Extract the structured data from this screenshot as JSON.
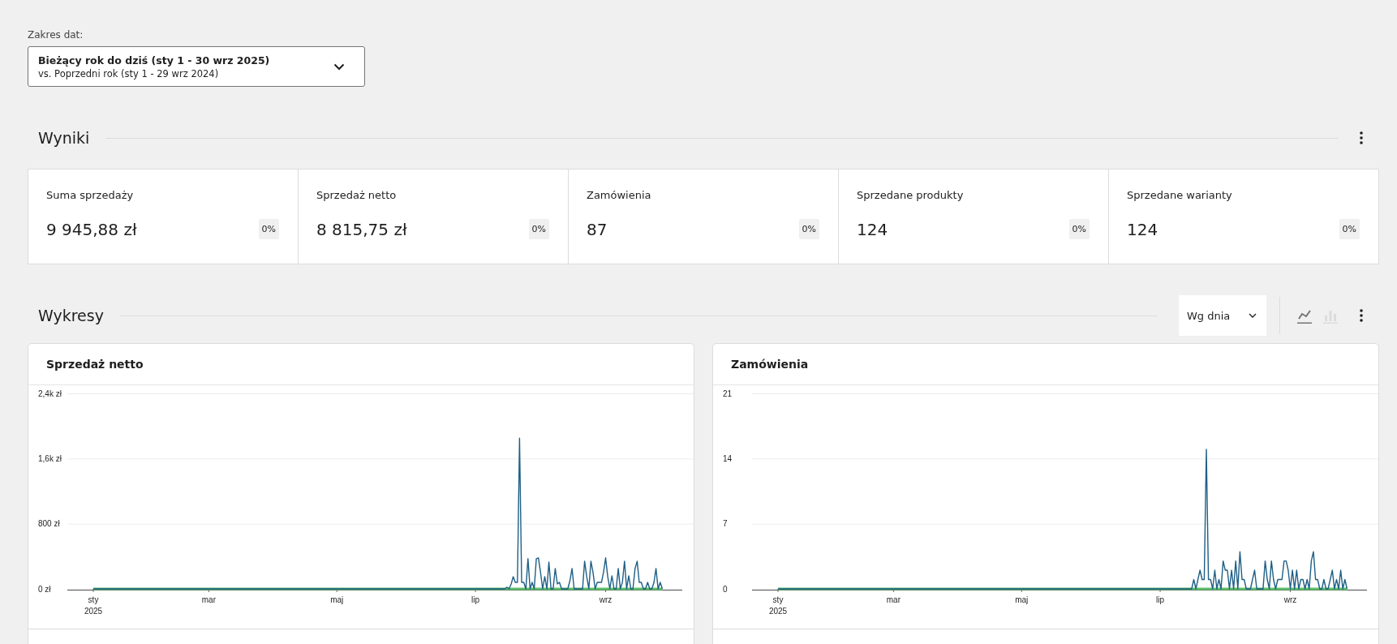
{
  "date_range": {
    "label": "Zakres dat:",
    "primary": "Bieżący rok do dziś (sty 1 - 30 wrz 2025)",
    "secondary": "vs. Poprzedni rok (sty 1 - 29 wrz 2024)"
  },
  "results": {
    "title": "Wyniki",
    "cards": [
      {
        "label": "Suma sprzedaży",
        "value": "9 945,88 zł",
        "delta": "0%"
      },
      {
        "label": "Sprzedaż netto",
        "value": "8 815,75 zł",
        "delta": "0%"
      },
      {
        "label": "Zamówienia",
        "value": "87",
        "delta": "0%"
      },
      {
        "label": "Sprzedane produkty",
        "value": "124",
        "delta": "0%"
      },
      {
        "label": "Sprzedane warianty",
        "value": "124",
        "delta": "0%"
      }
    ]
  },
  "charts": {
    "title": "Wykresy",
    "interval": "Wg dnia",
    "chart_types": [
      {
        "kind": "line",
        "selected": true
      },
      {
        "kind": "bar",
        "selected": false
      }
    ],
    "panels": [
      {
        "title": "Sprzedaż netto",
        "chart_data": {
          "type": "line",
          "categories": [
            "sty\n2025",
            null,
            null,
            null,
            null,
            null,
            null,
            null,
            null,
            null,
            null,
            null,
            null,
            null,
            null,
            null,
            null,
            null,
            null,
            null,
            null,
            null,
            null,
            null,
            null,
            null,
            null,
            null,
            null,
            null,
            null,
            null,
            null,
            null,
            null,
            null,
            null,
            null,
            null,
            null,
            null,
            null,
            null,
            null,
            null,
            null,
            null,
            null,
            null,
            null,
            null,
            null,
            null,
            null,
            null,
            "mar",
            null,
            null,
            null,
            null,
            null,
            null,
            null,
            null,
            null,
            null,
            null,
            null,
            null,
            null,
            null,
            null,
            null,
            null,
            null,
            null,
            null,
            null,
            null,
            null,
            null,
            null,
            null,
            null,
            null,
            null,
            null,
            null,
            null,
            null,
            null,
            null,
            null,
            null,
            null,
            null,
            null,
            null,
            null,
            null,
            null,
            null,
            null,
            null,
            null,
            null,
            null,
            null,
            null,
            null,
            null,
            null,
            null,
            null,
            null,
            null,
            "maj",
            null,
            null,
            null,
            null,
            null,
            null,
            null,
            null,
            null,
            null,
            null,
            null,
            null,
            null,
            null,
            null,
            null,
            null,
            null,
            null,
            null,
            null,
            null,
            null,
            null,
            null,
            null,
            null,
            null,
            null,
            null,
            null,
            null,
            null,
            null,
            null,
            null,
            null,
            null,
            null,
            null,
            null,
            null,
            null,
            null,
            null,
            null,
            null,
            null,
            null,
            null,
            null,
            null,
            null,
            null,
            null,
            null,
            null,
            null,
            null,
            null,
            null,
            null,
            null,
            null,
            "lip",
            null,
            null,
            null,
            null,
            null,
            null,
            null,
            null,
            null,
            null,
            null,
            null,
            null,
            null,
            null,
            null,
            null,
            null,
            null,
            null,
            null,
            null,
            null,
            null,
            null,
            null,
            null,
            null,
            null,
            null,
            null,
            null,
            null,
            null,
            null,
            null,
            null,
            null,
            null,
            null,
            null,
            null,
            null,
            null,
            null,
            null,
            null,
            null,
            null,
            null,
            null,
            null,
            null,
            null,
            null,
            null,
            null,
            null,
            null,
            null,
            null,
            "wrz",
            null,
            null,
            null,
            null,
            null,
            null,
            null,
            null,
            null,
            null,
            null,
            null,
            null,
            null,
            null,
            null,
            null,
            null,
            null,
            null,
            null,
            null,
            null,
            null,
            null,
            null,
            null
          ],
          "series": [
            {
              "color": "#1f5f86",
              "values": [
                0,
                0,
                0,
                0,
                0,
                0,
                0,
                0,
                0,
                0,
                0,
                0,
                0,
                0,
                0,
                0,
                0,
                0,
                0,
                0,
                0,
                0,
                0,
                0,
                0,
                0,
                0,
                0,
                0,
                0,
                0,
                0,
                0,
                0,
                0,
                0,
                0,
                0,
                0,
                0,
                0,
                0,
                0,
                0,
                0,
                0,
                0,
                0,
                0,
                0,
                0,
                0,
                0,
                0,
                0,
                0,
                0,
                0,
                0,
                0,
                0,
                0,
                0,
                0,
                0,
                0,
                0,
                0,
                0,
                0,
                0,
                0,
                0,
                0,
                0,
                0,
                0,
                0,
                0,
                0,
                0,
                0,
                0,
                0,
                0,
                0,
                0,
                0,
                0,
                0,
                0,
                0,
                0,
                0,
                0,
                0,
                0,
                0,
                0,
                0,
                0,
                0,
                0,
                0,
                0,
                0,
                0,
                0,
                0,
                0,
                0,
                0,
                0,
                0,
                0,
                0,
                0,
                0,
                0,
                0,
                0,
                0,
                0,
                0,
                0,
                0,
                0,
                0,
                0,
                0,
                0,
                0,
                0,
                0,
                0,
                0,
                0,
                0,
                0,
                0,
                0,
                0,
                0,
                0,
                0,
                0,
                0,
                0,
                0,
                0,
                0,
                0,
                0,
                0,
                0,
                0,
                0,
                0,
                0,
                0,
                0,
                0,
                0,
                0,
                0,
                0,
                0,
                0,
                0,
                0,
                0,
                0,
                0,
                0,
                0,
                0,
                0,
                0,
                0,
                0,
                0,
                0,
                0,
                0,
                0,
                0,
                0,
                0,
                0,
                0,
                0,
                0,
                0,
                0,
                0,
                0,
                0,
                20,
                0,
                60,
                150,
                80,
                80,
                1850,
                80,
                80,
                0,
                370,
                0,
                80,
                0,
                370,
                380,
                200,
                0,
                150,
                0,
                330,
                0,
                0,
                250,
                60,
                80,
                0,
                0,
                0,
                0,
                100,
                250,
                0,
                0,
                0,
                0,
                0,
                340,
                150,
                0,
                340,
                200,
                0,
                80,
                80,
                80,
                200,
                380,
                150,
                0,
                160,
                0,
                0,
                250,
                0,
                80,
                340,
                0,
                160,
                0,
                0,
                250,
                340,
                80,
                80,
                0,
                0,
                80,
                0,
                0,
                80,
                250,
                0,
                80,
                0
              ]
            },
            {
              "color": "#5ec26a",
              "values": [
                0,
                0,
                0,
                0,
                0,
                0,
                0,
                0,
                0,
                0,
                0,
                0,
                0,
                0,
                0,
                0,
                0,
                0,
                0,
                0,
                0,
                0,
                0,
                0,
                0,
                0,
                0,
                0,
                0,
                0,
                0,
                0,
                0,
                0,
                0,
                0,
                0,
                0,
                0,
                0,
                0,
                0,
                0,
                0,
                0,
                0,
                0,
                0,
                0,
                0,
                0,
                0,
                0,
                0,
                0,
                0,
                0,
                0,
                0,
                0,
                0,
                0,
                0,
                0,
                0,
                0,
                0,
                0,
                0,
                0,
                0,
                0,
                0,
                0,
                0,
                0,
                0,
                0,
                0,
                0,
                0,
                0,
                0,
                0,
                0,
                0,
                0,
                0,
                0,
                0,
                0,
                0,
                0,
                0,
                0,
                0,
                0,
                0,
                0,
                0,
                0,
                0,
                0,
                0,
                0,
                0,
                0,
                0,
                0,
                0,
                0,
                0,
                0,
                0,
                0,
                0,
                0,
                0,
                0,
                0,
                0,
                0,
                0,
                0,
                0,
                0,
                0,
                0,
                0,
                0,
                0,
                0,
                0,
                0,
                0,
                0,
                0,
                0,
                0,
                0,
                0,
                0,
                0,
                0,
                0,
                0,
                0,
                0,
                0,
                0,
                0,
                0,
                0,
                0,
                0,
                0,
                0,
                0,
                0,
                0,
                0,
                0,
                0,
                0,
                0,
                0,
                0,
                0,
                0,
                0,
                0,
                0,
                0,
                0,
                0,
                0,
                0,
                0,
                0,
                0,
                0,
                0,
                0,
                0,
                0,
                0,
                0,
                0,
                0,
                0,
                0,
                0,
                0,
                0,
                0,
                0,
                0,
                0,
                0,
                0,
                0,
                0,
                0,
                0,
                0,
                0,
                0,
                0,
                0,
                0,
                0,
                0,
                0,
                0,
                0,
                0,
                0,
                0,
                0,
                0,
                0,
                0,
                0,
                0,
                0,
                0,
                0,
                0,
                0,
                0,
                0,
                0,
                0,
                0,
                0,
                0,
                0,
                0,
                0,
                0,
                0,
                0,
                0,
                0,
                0,
                0,
                0,
                0,
                0,
                0,
                0,
                0,
                0,
                0,
                0,
                0,
                0,
                0,
                0,
                0,
                0,
                0,
                0,
                0,
                0,
                0,
                0,
                0,
                0,
                0,
                0,
                0
              ]
            }
          ],
          "ylim": [
            0,
            2400
          ],
          "yticks": [
            {
              "value": 0,
              "label": "0 zł"
            },
            {
              "value": 800,
              "label": "800 zł"
            },
            {
              "value": 1600,
              "label": "1,6k zł"
            },
            {
              "value": 2400,
              "label": "2,4k zł"
            }
          ]
        }
      },
      {
        "title": "Zamówienia",
        "chart_data": {
          "type": "line",
          "categories": [
            "sty\n2025",
            null,
            null,
            null,
            null,
            null,
            null,
            null,
            null,
            null,
            null,
            null,
            null,
            null,
            null,
            null,
            null,
            null,
            null,
            null,
            null,
            null,
            null,
            null,
            null,
            null,
            null,
            null,
            null,
            null,
            null,
            null,
            null,
            null,
            null,
            null,
            null,
            null,
            null,
            null,
            null,
            null,
            null,
            null,
            null,
            null,
            null,
            null,
            null,
            null,
            null,
            null,
            null,
            null,
            null,
            "mar",
            null,
            null,
            null,
            null,
            null,
            null,
            null,
            null,
            null,
            null,
            null,
            null,
            null,
            null,
            null,
            null,
            null,
            null,
            null,
            null,
            null,
            null,
            null,
            null,
            null,
            null,
            null,
            null,
            null,
            null,
            null,
            null,
            null,
            null,
            null,
            null,
            null,
            null,
            null,
            null,
            null,
            null,
            null,
            null,
            null,
            null,
            null,
            null,
            null,
            null,
            null,
            null,
            null,
            null,
            null,
            null,
            null,
            null,
            null,
            null,
            "maj",
            null,
            null,
            null,
            null,
            null,
            null,
            null,
            null,
            null,
            null,
            null,
            null,
            null,
            null,
            null,
            null,
            null,
            null,
            null,
            null,
            null,
            null,
            null,
            null,
            null,
            null,
            null,
            null,
            null,
            null,
            null,
            null,
            null,
            null,
            null,
            null,
            null,
            null,
            null,
            null,
            null,
            null,
            null,
            null,
            null,
            null,
            null,
            null,
            null,
            null,
            null,
            null,
            null,
            null,
            null,
            null,
            null,
            null,
            null,
            null,
            null,
            null,
            null,
            null,
            null,
            "lip",
            null,
            null,
            null,
            null,
            null,
            null,
            null,
            null,
            null,
            null,
            null,
            null,
            null,
            null,
            null,
            null,
            null,
            null,
            null,
            null,
            null,
            null,
            null,
            null,
            null,
            null,
            null,
            null,
            null,
            null,
            null,
            null,
            null,
            null,
            null,
            null,
            null,
            null,
            null,
            null,
            null,
            null,
            null,
            null,
            null,
            null,
            null,
            null,
            null,
            null,
            null,
            null,
            null,
            null,
            null,
            null,
            null,
            null,
            null,
            null,
            null,
            "wrz",
            null,
            null,
            null,
            null,
            null,
            null,
            null,
            null,
            null,
            null,
            null,
            null,
            null,
            null,
            null,
            null,
            null,
            null,
            null,
            null,
            null,
            null,
            null,
            null,
            null,
            null,
            null
          ],
          "series": [
            {
              "color": "#1f5f86",
              "values": [
                0,
                0,
                0,
                0,
                0,
                0,
                0,
                0,
                0,
                0,
                0,
                0,
                0,
                0,
                0,
                0,
                0,
                0,
                0,
                0,
                0,
                0,
                0,
                0,
                0,
                0,
                0,
                0,
                0,
                0,
                0,
                0,
                0,
                0,
                0,
                0,
                0,
                0,
                0,
                0,
                0,
                0,
                0,
                0,
                0,
                0,
                0,
                0,
                0,
                0,
                0,
                0,
                0,
                0,
                0,
                0,
                0,
                0,
                0,
                0,
                0,
                0,
                0,
                0,
                0,
                0,
                0,
                0,
                0,
                0,
                0,
                0,
                0,
                0,
                0,
                0,
                0,
                0,
                0,
                0,
                0,
                0,
                0,
                0,
                0,
                0,
                0,
                0,
                0,
                0,
                0,
                0,
                0,
                0,
                0,
                0,
                0,
                0,
                0,
                0,
                0,
                0,
                0,
                0,
                0,
                0,
                0,
                0,
                0,
                0,
                0,
                0,
                0,
                0,
                0,
                0,
                0,
                0,
                0,
                0,
                0,
                0,
                0,
                0,
                0,
                0,
                0,
                0,
                0,
                0,
                0,
                0,
                0,
                0,
                0,
                0,
                0,
                0,
                0,
                0,
                0,
                0,
                0,
                0,
                0,
                0,
                0,
                0,
                0,
                0,
                0,
                0,
                0,
                0,
                0,
                0,
                0,
                0,
                0,
                0,
                0,
                0,
                0,
                0,
                0,
                0,
                0,
                0,
                0,
                0,
                0,
                0,
                0,
                0,
                0,
                0,
                0,
                0,
                0,
                0,
                0,
                0,
                0,
                0,
                0,
                0,
                0,
                0,
                0,
                0,
                0,
                0,
                0,
                0,
                0,
                0,
                0,
                0,
                1,
                0,
                1,
                2,
                1,
                1,
                15,
                1,
                1,
                0,
                2,
                0,
                1,
                0,
                3,
                2,
                2,
                0,
                2,
                0,
                3,
                0,
                4,
                1,
                1,
                0,
                0,
                0,
                1,
                2,
                0,
                0,
                0,
                0,
                3,
                1,
                0,
                3,
                1,
                0,
                1,
                1,
                1,
                3,
                3,
                2,
                0,
                2,
                0,
                2,
                0,
                1,
                1,
                0,
                1,
                0,
                3,
                4,
                1,
                1,
                0,
                0,
                1,
                0,
                0,
                1,
                2,
                0,
                1,
                0,
                2,
                0,
                1,
                0
              ]
            },
            {
              "color": "#5ec26a",
              "values": [
                0,
                0,
                0,
                0,
                0,
                0,
                0,
                0,
                0,
                0,
                0,
                0,
                0,
                0,
                0,
                0,
                0,
                0,
                0,
                0,
                0,
                0,
                0,
                0,
                0,
                0,
                0,
                0,
                0,
                0,
                0,
                0,
                0,
                0,
                0,
                0,
                0,
                0,
                0,
                0,
                0,
                0,
                0,
                0,
                0,
                0,
                0,
                0,
                0,
                0,
                0,
                0,
                0,
                0,
                0,
                0,
                0,
                0,
                0,
                0,
                0,
                0,
                0,
                0,
                0,
                0,
                0,
                0,
                0,
                0,
                0,
                0,
                0,
                0,
                0,
                0,
                0,
                0,
                0,
                0,
                0,
                0,
                0,
                0,
                0,
                0,
                0,
                0,
                0,
                0,
                0,
                0,
                0,
                0,
                0,
                0,
                0,
                0,
                0,
                0,
                0,
                0,
                0,
                0,
                0,
                0,
                0,
                0,
                0,
                0,
                0,
                0,
                0,
                0,
                0,
                0,
                0,
                0,
                0,
                0,
                0,
                0,
                0,
                0,
                0,
                0,
                0,
                0,
                0,
                0,
                0,
                0,
                0,
                0,
                0,
                0,
                0,
                0,
                0,
                0,
                0,
                0,
                0,
                0,
                0,
                0,
                0,
                0,
                0,
                0,
                0,
                0,
                0,
                0,
                0,
                0,
                0,
                0,
                0,
                0,
                0,
                0,
                0,
                0,
                0,
                0,
                0,
                0,
                0,
                0,
                0,
                0,
                0,
                0,
                0,
                0,
                0,
                0,
                0,
                0,
                0,
                0,
                0,
                0,
                0,
                0,
                0,
                0,
                0,
                0,
                0,
                0,
                0,
                0,
                0,
                0,
                0,
                0,
                0,
                0,
                0,
                0,
                0,
                0,
                0,
                0,
                0,
                0,
                0,
                0,
                0,
                0,
                0,
                0,
                0,
                0,
                0,
                0,
                0,
                0,
                0,
                0,
                0,
                0,
                0,
                0,
                0,
                0,
                0,
                0,
                0,
                0,
                0,
                0,
                0,
                0,
                0,
                0,
                0,
                0,
                0,
                0,
                0,
                0,
                0,
                0,
                0,
                0,
                0,
                0,
                0,
                0,
                0,
                0,
                0,
                0,
                0,
                0,
                0,
                0,
                0,
                0,
                0,
                0,
                0,
                0,
                0,
                0,
                0,
                0,
                0,
                0
              ]
            }
          ],
          "ylim": [
            0,
            21
          ],
          "yticks": [
            {
              "value": 0,
              "label": "0"
            },
            {
              "value": 7,
              "label": "7"
            },
            {
              "value": 14,
              "label": "14"
            },
            {
              "value": 21,
              "label": "21"
            }
          ]
        }
      }
    ]
  }
}
